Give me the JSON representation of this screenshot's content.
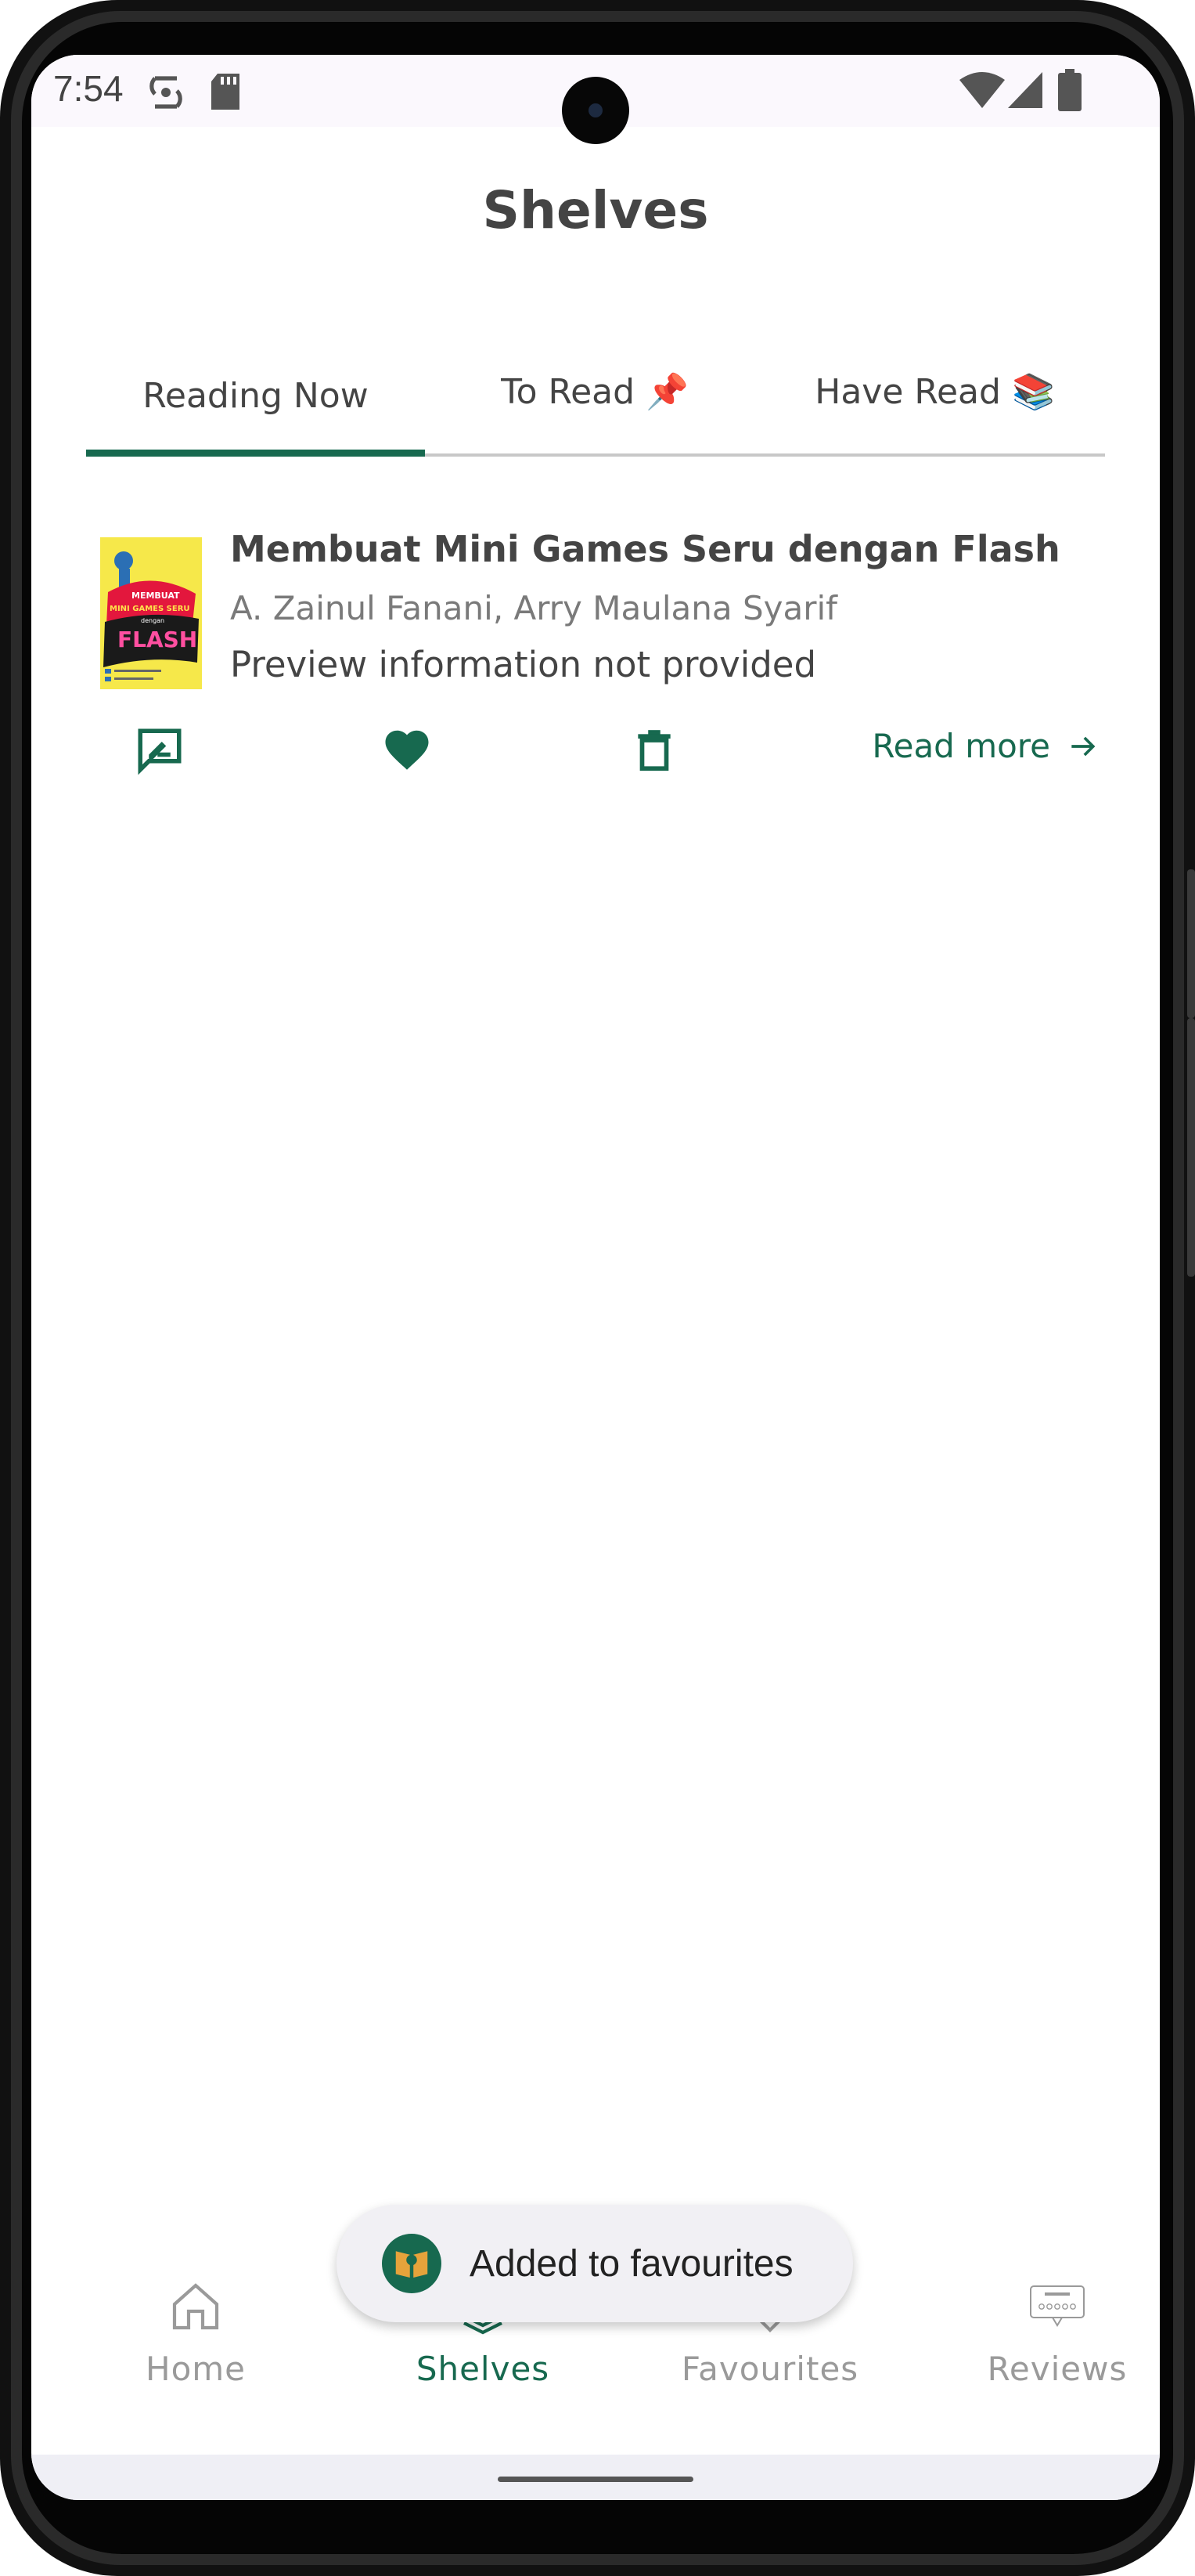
{
  "status_bar": {
    "time": "7:54",
    "left_icons": [
      "sync-icon",
      "sd-card-icon"
    ],
    "right_icons": [
      "wifi-icon",
      "signal-icon",
      "battery-icon"
    ]
  },
  "page": {
    "title": "Shelves"
  },
  "tabs": [
    {
      "label": "Reading Now",
      "selected": true
    },
    {
      "label": "To Read 📌",
      "selected": false
    },
    {
      "label": "Have Read 📚",
      "selected": false
    }
  ],
  "book": {
    "title": "Membuat Mini Games Seru dengan Flash",
    "authors": "A. Zainul Fanani, Arry Maulana Syarif",
    "preview": "Preview information not provided",
    "cover_text": {
      "line1": "MEMBUAT",
      "line2": "MINI GAMES SERU",
      "line3": "dengan",
      "line4": "FLASH"
    },
    "actions": {
      "review_icon": "rate-review-icon",
      "favourite_icon": "heart-icon",
      "delete_icon": "trash-icon",
      "read_more_label": "Read more"
    }
  },
  "snackbar": {
    "message": "Added to favourites"
  },
  "bottom_nav": [
    {
      "label": "Home",
      "icon": "home-icon",
      "active": false
    },
    {
      "label": "Shelves",
      "icon": "shelves-icon",
      "active": true
    },
    {
      "label": "Favourites",
      "icon": "heart-outline-icon",
      "active": false
    },
    {
      "label": "Reviews",
      "icon": "reviews-icon",
      "active": false
    }
  ],
  "colors": {
    "accent": "#17694f",
    "text_primary": "#444444",
    "text_secondary": "#7a7a7a",
    "nav_inactive": "#9a9a9a",
    "snackbar_bg": "#f1f0f4"
  }
}
